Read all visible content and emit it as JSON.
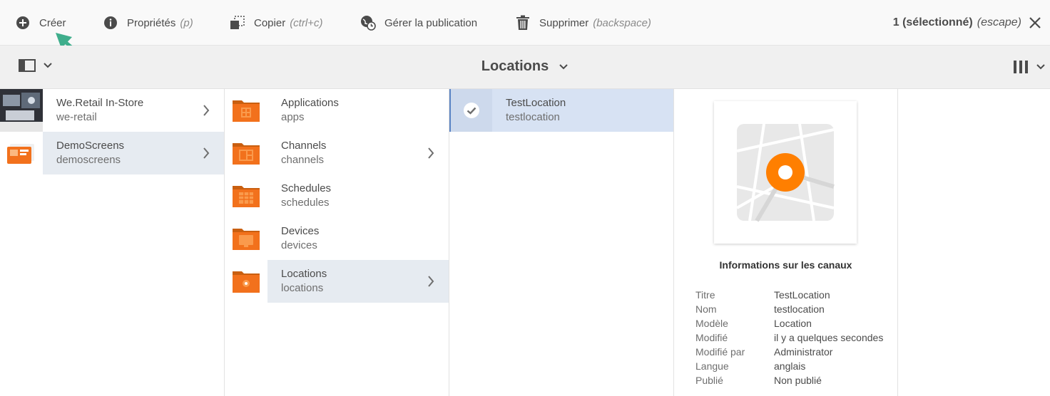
{
  "actionbar": {
    "create_label": "Créer",
    "properties_label": "Propriétés",
    "properties_hint": "(p)",
    "copy_label": "Copier",
    "copy_hint": "(ctrl+c)",
    "publish_label": "Gérer la publication",
    "delete_label": "Supprimer",
    "delete_hint": "(backspace)",
    "selection_label": "1 (sélectionné)",
    "selection_hint": "(escape)"
  },
  "titlebar": {
    "title": "Locations"
  },
  "columns": [
    {
      "items": [
        {
          "title": "We.Retail In-Store",
          "subtitle": "we-retail",
          "thumb": "photo-thumbnail",
          "has_children": true,
          "active": false
        },
        {
          "title": "DemoScreens",
          "subtitle": "demoscreens",
          "thumb": "screens-thumbnail",
          "has_children": true,
          "active": true
        }
      ]
    },
    {
      "items": [
        {
          "title": "Applications",
          "subtitle": "apps",
          "thumb": "folder-icon",
          "has_children": false,
          "active": false
        },
        {
          "title": "Channels",
          "subtitle": "channels",
          "thumb": "folder-icon",
          "has_children": true,
          "active": false
        },
        {
          "title": "Schedules",
          "subtitle": "schedules",
          "thumb": "folder-icon",
          "has_children": false,
          "active": false
        },
        {
          "title": "Devices",
          "subtitle": "devices",
          "thumb": "folder-icon",
          "has_children": false,
          "active": false
        },
        {
          "title": "Locations",
          "subtitle": "locations",
          "thumb": "folder-icon",
          "has_children": true,
          "active": true
        }
      ]
    },
    {
      "items": [
        {
          "title": "TestLocation",
          "subtitle": "testlocation",
          "thumb": "checkmark-icon",
          "selected": true
        }
      ]
    }
  ],
  "preview": {
    "info_title": "Informations sur les canaux",
    "meta": [
      {
        "key": "Titre",
        "value": "TestLocation"
      },
      {
        "key": "Nom",
        "value": "testlocation"
      },
      {
        "key": "Modèle",
        "value": "Location"
      },
      {
        "key": "Modifié",
        "value": "il y a quelques secondes"
      },
      {
        "key": "Modifié par",
        "value": "Administrator"
      },
      {
        "key": "Langue",
        "value": "anglais"
      },
      {
        "key": "Publié",
        "value": "Non publié"
      }
    ]
  },
  "colors": {
    "accent_orange": "#ff7f00",
    "folder_orange": "#f2711c",
    "selection_blue": "#d7e2f3",
    "arrow_green": "#3fae8c"
  }
}
